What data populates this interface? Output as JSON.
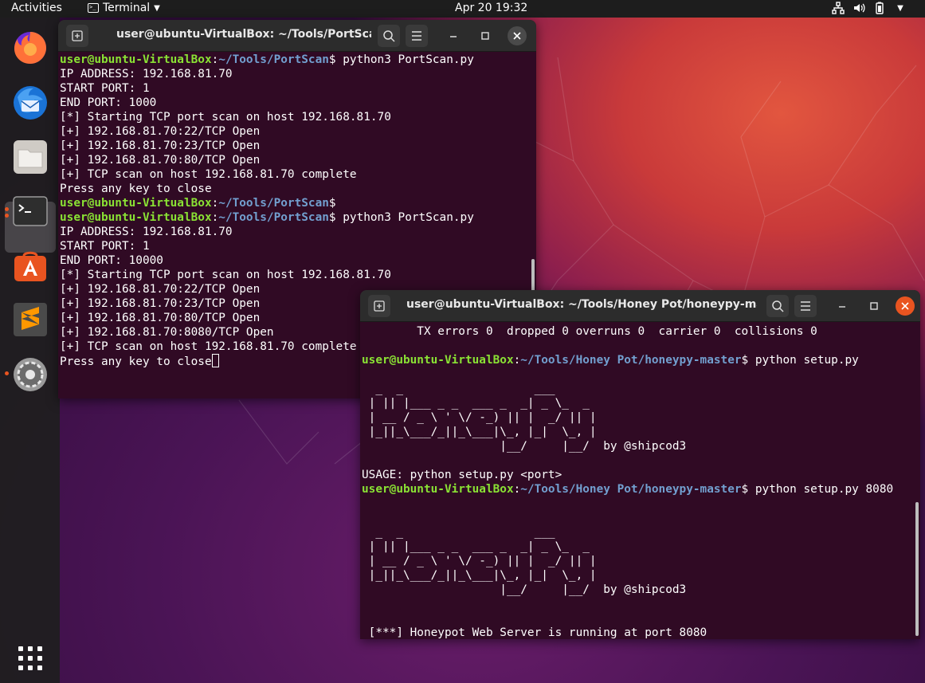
{
  "topbar": {
    "activities": "Activities",
    "app_name": "Terminal",
    "clock": "Apr 20  19:32",
    "tray_icons": [
      "network-icon",
      "volume-icon",
      "battery-icon",
      "system-menu-chevron-icon"
    ]
  },
  "dock": {
    "items": [
      "firefox-icon",
      "thunderbird-icon",
      "files-icon",
      "terminal-icon",
      "ubuntu-software-icon",
      "sublime-text-icon",
      "settings-icon",
      "show-applications-icon"
    ]
  },
  "window1": {
    "title": "user@ubuntu-VirtualBox: ~/Tools/PortScan",
    "prompt_user": "user@ubuntu-VirtualBox",
    "prompt_sep": ":",
    "prompt_path": "~/Tools/PortScan",
    "prompt_end": "$",
    "lines": [
      {
        "cmd": " python3 PortScan.py"
      },
      {
        "text": "IP ADDRESS: 192.168.81.70"
      },
      {
        "text": "START PORT: 1"
      },
      {
        "text": "END PORT: 1000"
      },
      {
        "text": "[*] Starting TCP port scan on host 192.168.81.70"
      },
      {
        "text": "[+] 192.168.81.70:22/TCP Open"
      },
      {
        "text": "[+] 192.168.81.70:23/TCP Open"
      },
      {
        "text": "[+] 192.168.81.70:80/TCP Open"
      },
      {
        "text": "[+] TCP scan on host 192.168.81.70 complete"
      },
      {
        "text": "Press any key to close"
      },
      {
        "cmd": ""
      },
      {
        "cmd": " python3 PortScan.py"
      },
      {
        "text": "IP ADDRESS: 192.168.81.70"
      },
      {
        "text": "START PORT: 1"
      },
      {
        "text": "END PORT: 10000"
      },
      {
        "text": "[*] Starting TCP port scan on host 192.168.81.70"
      },
      {
        "text": "[+] 192.168.81.70:22/TCP Open"
      },
      {
        "text": "[+] 192.168.81.70:23/TCP Open"
      },
      {
        "text": "[+] 192.168.81.70:80/TCP Open"
      },
      {
        "text": "[+] 192.168.81.70:8080/TCP Open"
      },
      {
        "text": "[+] TCP scan on host 192.168.81.70 complete"
      },
      {
        "text": "Press any key to close",
        "cursor": true
      }
    ]
  },
  "window2": {
    "title": "user@ubuntu-VirtualBox: ~/Tools/Honey Pot/honeypy-ma...",
    "prompt_user": "user@ubuntu-VirtualBox",
    "prompt_sep": ":",
    "prompt_path": "~/Tools/Honey Pot/honeypy-master",
    "prompt_end": "$",
    "lines": [
      {
        "text": "        TX errors 0  dropped 0 overruns 0  carrier 0  collisions 0"
      },
      {
        "text": ""
      },
      {
        "cmd": " python setup.py"
      },
      {
        "text": ""
      },
      {
        "text": "  _  _                   ___"
      },
      {
        "text": " | || |___ _ _  ___ _  _| _ \\_  _"
      },
      {
        "text": " | __ / _ \\ ' \\/ -_) || |  _/ || |"
      },
      {
        "text": " |_||_\\___/_||_\\___|\\_, |_|  \\_, |"
      },
      {
        "text": "                    |__/     |__/  by @shipcod3"
      },
      {
        "text": ""
      },
      {
        "text": "USAGE: python setup.py <port>"
      },
      {
        "cmd": " python setup.py 8080"
      },
      {
        "text": ""
      },
      {
        "text": ""
      },
      {
        "text": "  _  _                   ___"
      },
      {
        "text": " | || |___ _ _  ___ _  _| _ \\_  _"
      },
      {
        "text": " | __ / _ \\ ' \\/ -_) || |  _/ || |"
      },
      {
        "text": " |_||_\\___/_||_\\___|\\_, |_|  \\_, |"
      },
      {
        "text": "                    |__/     |__/  by @shipcod3"
      },
      {
        "text": ""
      },
      {
        "text": ""
      },
      {
        "text": " [***] Honeypot Web Server is running at port 8080"
      },
      {
        "text": "",
        "cursor": true
      }
    ]
  }
}
